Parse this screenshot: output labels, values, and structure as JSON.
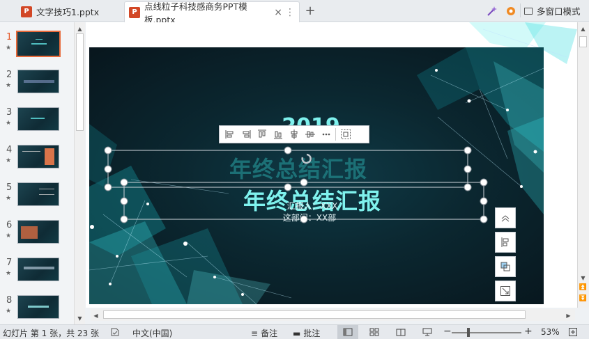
{
  "tabs": [
    {
      "label": "文字技巧1.pptx",
      "icon": "P"
    },
    {
      "label": "点线粒子科技感商务PPT模板.pptx",
      "icon": "P"
    }
  ],
  "topbar": {
    "multiwindow_label": "多窗口模式",
    "add_tab": "+",
    "close": "×",
    "more": "⋮"
  },
  "thumbnails": [
    {
      "num": "1",
      "star": "★"
    },
    {
      "num": "2",
      "star": "★"
    },
    {
      "num": "3",
      "star": "★"
    },
    {
      "num": "4",
      "star": "★"
    },
    {
      "num": "5",
      "star": "★"
    },
    {
      "num": "6",
      "star": "★"
    },
    {
      "num": "7",
      "star": "★"
    },
    {
      "num": "8",
      "star": "★"
    }
  ],
  "slide": {
    "year": "2019",
    "title_shadow": "年终总结汇报",
    "title": "年终总结汇报",
    "reporter": "汇报人：XXX",
    "department": "这部门：XX部"
  },
  "status": {
    "slide_info": "幻灯片 第 1 张，共 23 张",
    "language": "中文(中国)",
    "notes": "备注",
    "comments": "批注",
    "zoom": "53%",
    "zoom_minus": "−",
    "zoom_plus": "+"
  },
  "colors": {
    "accent": "#e35b2d",
    "slide_bg": "#0b2730",
    "title_cyan": "#7ff2ee"
  }
}
